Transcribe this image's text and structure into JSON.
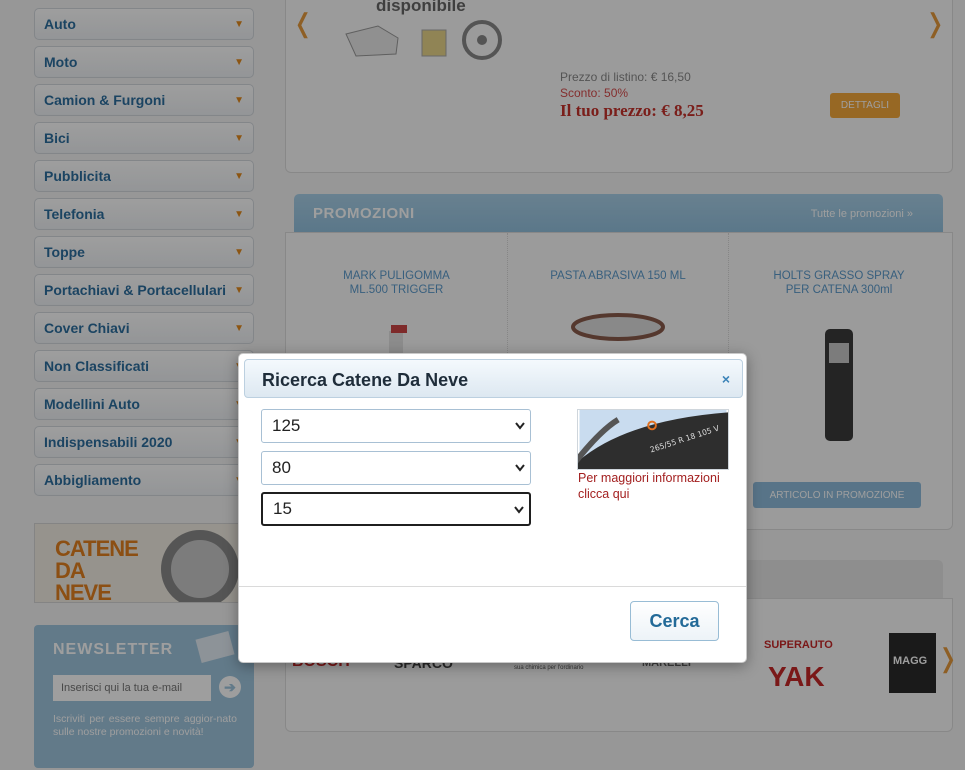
{
  "sidebar": {
    "categories": [
      {
        "label": "Auto"
      },
      {
        "label": "Moto"
      },
      {
        "label": "Camion & Furgoni"
      },
      {
        "label": "Bici"
      },
      {
        "label": "Pubblicita"
      },
      {
        "label": "Telefonia"
      },
      {
        "label": "Toppe"
      },
      {
        "label": "Portachiavi & Portacellulari"
      },
      {
        "label": "Cover Chiavi"
      },
      {
        "label": "Non Classificati"
      },
      {
        "label": "Modellini Auto"
      },
      {
        "label": "Indispensabili 2020"
      },
      {
        "label": "Abbigliamento"
      }
    ],
    "banner_text": "CATENE DA NEVE",
    "newsletter": {
      "title": "NEWSLETTER",
      "email_placeholder": "Inserisci qui la tua e-mail",
      "description": "Iscriviti per essere sempre aggior-nato sulle nostre promozioni e novità!"
    }
  },
  "featured": {
    "availability": "disponibile",
    "list_price": "Prezzo di listino: € 16,50",
    "discount": "Sconto: 50%",
    "your_price": "Il tuo prezzo: € 8,25",
    "details_button": "DETTAGLI"
  },
  "promotions": {
    "title": "PROMOZIONI",
    "all_link": "Tutte le promozioni »",
    "products": [
      {
        "name": "MARK PULIGOMMA ML.500 TRIGGER"
      },
      {
        "name": "PASTA ABRASIVA 150 ML"
      },
      {
        "name": "HOLTS GRASSO SPRAY PER CATENA 300ml"
      }
    ],
    "promo_button": "ARTICOLO IN PROMOZIONE"
  },
  "brands": [
    {
      "name": "BOSCH"
    },
    {
      "name": "SPARCO"
    },
    {
      "name": "sua chimica per l'ordinario"
    },
    {
      "name": "MARELLI"
    },
    {
      "name": "SUPERAUTO"
    },
    {
      "name": "YAK"
    },
    {
      "name": "MAGG"
    }
  ],
  "modal": {
    "title": "Ricerca Catene Da Neve",
    "close_glyph": "×",
    "selects": [
      {
        "value": "125"
      },
      {
        "value": "80"
      },
      {
        "value": "15"
      }
    ],
    "info_link": "Per maggiori informazioni clicca qui",
    "search_button": "Cerca"
  },
  "colors": {
    "link_blue": "#2d6e9e",
    "accent_orange": "#e38a1d",
    "price_red": "#c5312b",
    "info_red": "#a31f1f"
  }
}
